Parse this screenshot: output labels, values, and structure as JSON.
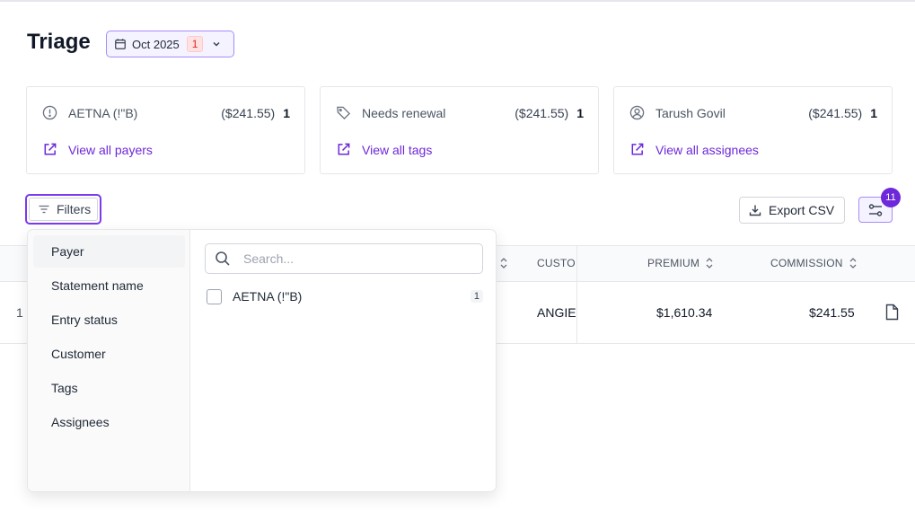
{
  "page": {
    "title": "Triage"
  },
  "date_filter": {
    "label": "Oct 2025",
    "badge": "1"
  },
  "cards": [
    {
      "icon": "alert-circle-icon",
      "label": "AETNA (!\"B)",
      "amount": "($241.55)",
      "count": "1",
      "link": "View all payers"
    },
    {
      "icon": "tag-icon",
      "label": "Needs renewal",
      "amount": "($241.55)",
      "count": "1",
      "link": "View all tags"
    },
    {
      "icon": "user-circle-icon",
      "label": "Tarush Govil",
      "amount": "($241.55)",
      "count": "1",
      "link": "View all assignees"
    }
  ],
  "toolbar": {
    "filters_label": "Filters",
    "export_label": "Export CSV",
    "columns_badge": "11"
  },
  "table": {
    "headers": {
      "customer": "CUSTO",
      "premium": "PREMIUM",
      "commission": "COMMISSION"
    },
    "row": {
      "first_cell": "1",
      "customer": "ANGIE",
      "premium": "$1,610.34",
      "commission": "$241.55"
    }
  },
  "filter_menu": {
    "categories": [
      "Payer",
      "Statement name",
      "Entry status",
      "Customer",
      "Tags",
      "Assignees"
    ],
    "active_category": "Payer",
    "search_placeholder": "Search...",
    "options": [
      {
        "label": "AETNA (!\"B)",
        "count": "1"
      }
    ]
  },
  "colors": {
    "accent": "#7c3aed",
    "link": "#6d28d9",
    "badge_red": "#dc2626"
  }
}
